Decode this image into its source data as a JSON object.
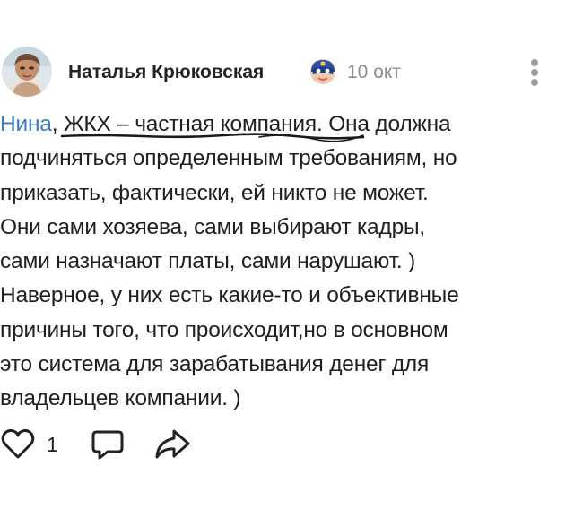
{
  "post": {
    "author": "Наталья Крюковская",
    "date": "10 окт",
    "mention": "Нина",
    "highlight": "ЖКХ – частная компания",
    "lines": [
      ". Она должна",
      "подчиняться определенным требованиям, но",
      "приказать, фактически, ей никто не может.",
      "Они сами хозяева, сами выбирают кадры,",
      "сами назначают платы, сами нарушают. )",
      "Наверное, у них есть какие-то и объективные",
      "причины того, что происходит,но в основном",
      "это система для зарабатывания денег для",
      "владельцев компании. )"
    ]
  },
  "actions": {
    "likes": "1"
  },
  "icons": {
    "avatar": "avatar-photo",
    "badge": "superhero-mask-badge-icon",
    "menu": "vertical-dots-icon",
    "like": "heart-icon",
    "comment": "comment-bubble-icon",
    "share": "share-arrow-icon"
  },
  "colors": {
    "mention": "#3a7dbf",
    "date": "#8c8c8c",
    "icon": "#222222"
  }
}
